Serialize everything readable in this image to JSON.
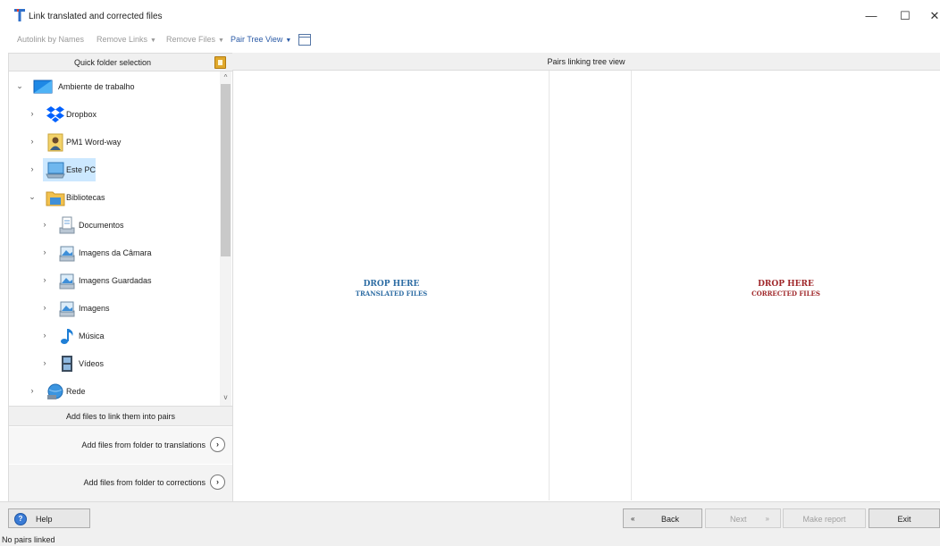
{
  "window": {
    "title": "Link translated and corrected files",
    "controls": {
      "minimize": "—",
      "maximize": "☐",
      "close": "✕"
    }
  },
  "toolbar": {
    "autolink_label": "Autolink by Names",
    "remove_links_label": "Remove Links",
    "remove_files_label": "Remove Files",
    "pair_tree_view_label": "Pair Tree View",
    "dropdown_caret": "▼"
  },
  "left_panel": {
    "quick_folder_title": "Quick folder selection",
    "tree": [
      {
        "label": "Ambiente de trabalho",
        "icon": "desktop-icon",
        "chevron": "⌄"
      },
      {
        "label": "Dropbox",
        "icon": "dropbox-icon",
        "chevron": "›"
      },
      {
        "label": "PM1 Word-way",
        "icon": "user-folder-icon",
        "chevron": "›"
      },
      {
        "label": "Este PC",
        "icon": "computer-icon",
        "chevron": "›",
        "selected": true
      },
      {
        "label": "Bibliotecas",
        "icon": "libraries-icon",
        "chevron": "⌄"
      },
      {
        "label": "Documentos",
        "icon": "documents-icon",
        "chevron": "›"
      },
      {
        "label": "Imagens da Câmara",
        "icon": "pictures-library-icon",
        "chevron": "›"
      },
      {
        "label": "Imagens Guardadas",
        "icon": "pictures-library-icon",
        "chevron": "›"
      },
      {
        "label": "Imagens",
        "icon": "pictures-library-icon",
        "chevron": "›"
      },
      {
        "label": "Música",
        "icon": "music-icon",
        "chevron": "›"
      },
      {
        "label": "Vídeos",
        "icon": "videos-icon",
        "chevron": "›"
      },
      {
        "label": "Rede",
        "icon": "network-icon",
        "chevron": "›"
      }
    ],
    "scroll_up": "^",
    "scroll_down": "v",
    "add_files_title": "Add files to link them into pairs",
    "add_translations_label": "Add files from folder to translations",
    "add_corrections_label": "Add files from folder to corrections",
    "go_glyph": "›"
  },
  "right_panel": {
    "header": "Pairs linking tree view",
    "translated": {
      "main": "DROP HERE",
      "sub": "TRANSLATED FILES"
    },
    "corrected": {
      "main": "DROP HERE",
      "sub": "CORRECTED FILES"
    }
  },
  "bottom": {
    "help_label": "Help",
    "help_glyph": "?",
    "back_label": "Back",
    "back_arrow": "«",
    "next_label": "Next",
    "next_arrow": "»",
    "report_label": "Make report",
    "exit_label": "Exit"
  },
  "status": {
    "text": "No pairs linked"
  },
  "colors": {
    "drop_translated": "#2e6da4",
    "drop_corrected": "#a0282b",
    "selection": "#cce8ff",
    "accent": "#2a5aa6"
  }
}
